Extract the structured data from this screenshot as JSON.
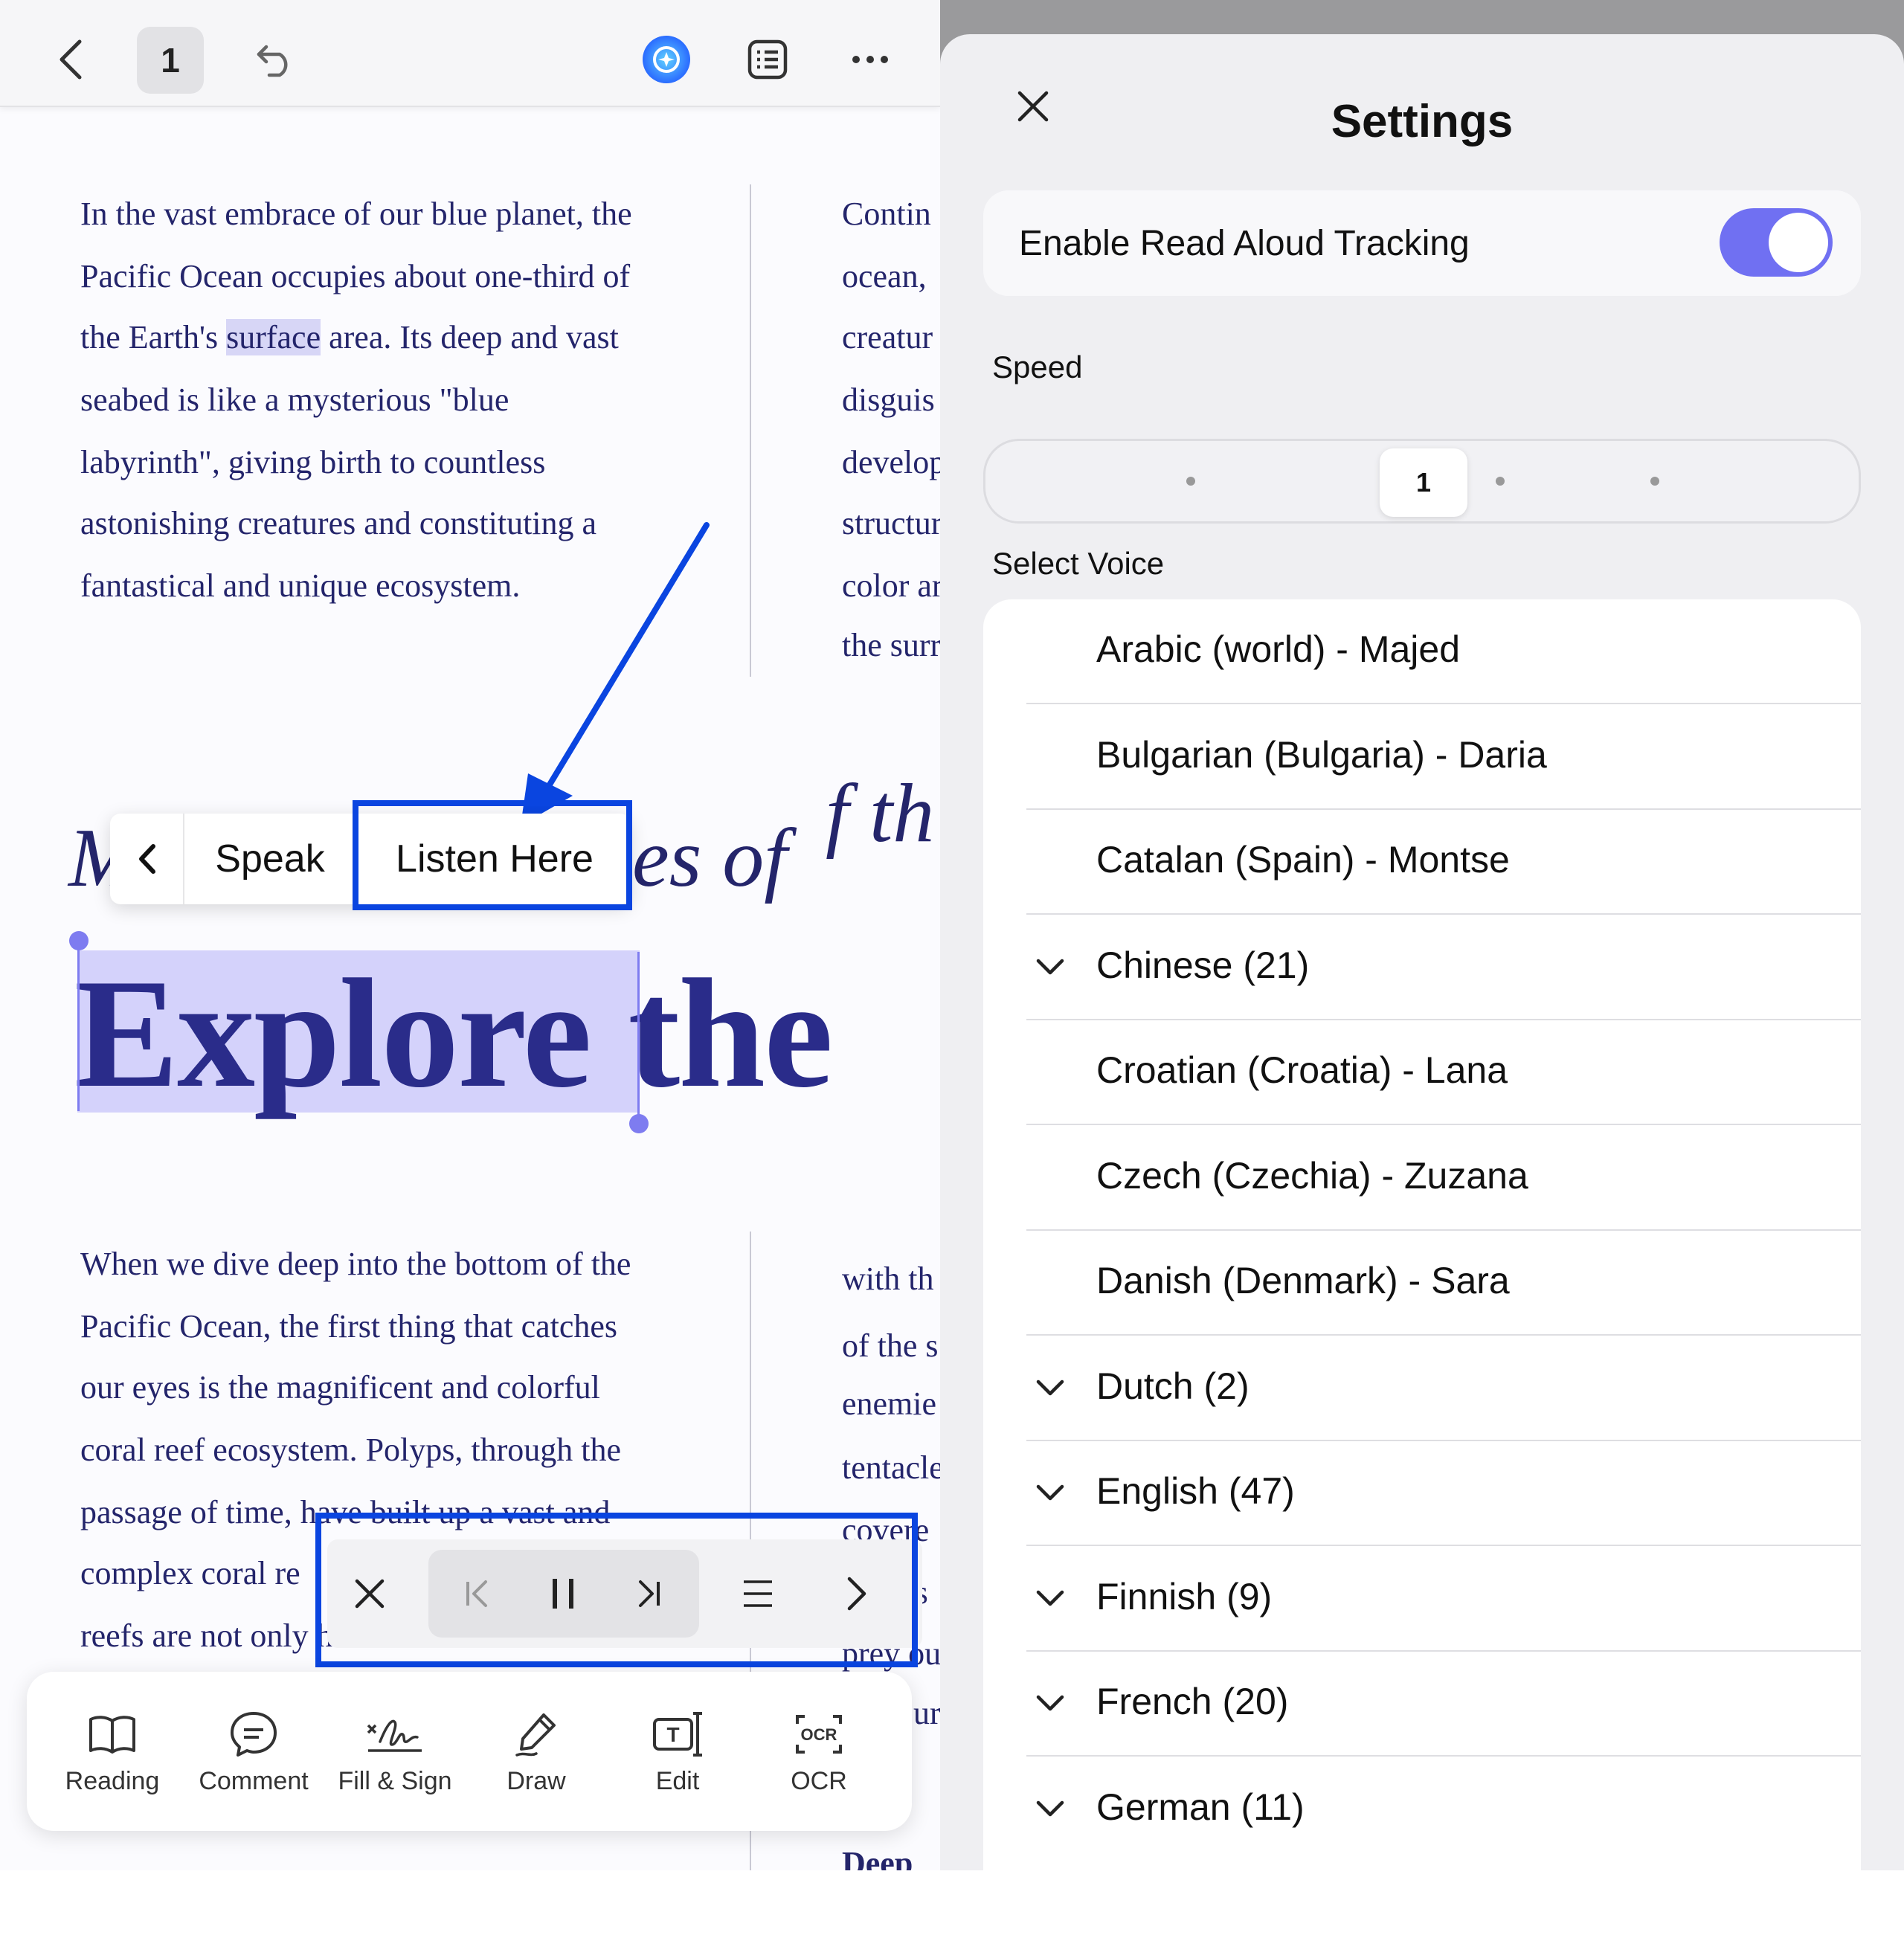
{
  "left": {
    "topbar": {
      "page_number": "1"
    },
    "paragraph1": [
      "In the vast embrace of our blue planet, the",
      "Pacific Ocean occupies about one-third of",
      "the Earth's |surface| area. Its deep and vast",
      "seabed is like a mysterious \"blue",
      "labyrinth\", giving birth to countless",
      "astonishing creatures and constituting a",
      "fantastical and unique ecosystem."
    ],
    "highlighted_word": "surface",
    "col2_top": [
      "Contin",
      "ocean,",
      "creatur",
      "disguis",
      "develop",
      "structur",
      "color ar",
      "the surr"
    ],
    "heading_script_left": "M",
    "heading_script_mid": "es of",
    "heading_script_right": "f th",
    "heading_big_selected": "Explore",
    "heading_big_rest": "the",
    "paragraph2": [
      "When we dive deep into the bottom of the",
      "Pacific Ocean, the first thing that catches",
      "our eyes is the magnificent and colorful",
      "coral reef ecosystem. Polyps, through the",
      "passage of time, have built up a vast and",
      "complex coral re",
      "reefs are not only habitats for themselves"
    ],
    "col2_bottom": [
      "with th",
      "of the s",
      "enemie",
      "tentacle",
      "covere",
      "rs",
      "prey ou",
      "ur",
      "Deep"
    ],
    "context_menu": {
      "speak": "Speak",
      "listen_here": "Listen Here"
    },
    "toolbar": [
      {
        "label": "Reading",
        "icon": "book-icon"
      },
      {
        "label": "Comment",
        "icon": "comment-icon"
      },
      {
        "label": "Fill & Sign",
        "icon": "signature-icon"
      },
      {
        "label": "Draw",
        "icon": "pen-icon"
      },
      {
        "label": "Edit",
        "icon": "text-edit-icon"
      },
      {
        "label": "OCR",
        "icon": "ocr-icon"
      }
    ],
    "accent_outline": "#0a45e0"
  },
  "settings": {
    "title": "Settings",
    "tracking_label": "Enable Read Aloud Tracking",
    "tracking_enabled": true,
    "speed_label": "Speed",
    "speed_value": "1",
    "select_voice_label": "Select Voice",
    "voices": [
      {
        "label": "Arabic (world) - Majed",
        "expandable": false
      },
      {
        "label": "Bulgarian (Bulgaria) - Daria",
        "expandable": false
      },
      {
        "label": "Catalan (Spain) - Montse",
        "expandable": false
      },
      {
        "label": "Chinese (21)",
        "expandable": true
      },
      {
        "label": "Croatian (Croatia) - Lana",
        "expandable": false
      },
      {
        "label": "Czech (Czechia) - Zuzana",
        "expandable": false
      },
      {
        "label": "Danish (Denmark) - Sara",
        "expandable": false
      },
      {
        "label": "Dutch (2)",
        "expandable": true
      },
      {
        "label": "English (47)",
        "expandable": true
      },
      {
        "label": "Finnish (9)",
        "expandable": true
      },
      {
        "label": "French (20)",
        "expandable": true
      },
      {
        "label": "German (11)",
        "expandable": true
      }
    ],
    "toggle_color": "#7070f2"
  }
}
